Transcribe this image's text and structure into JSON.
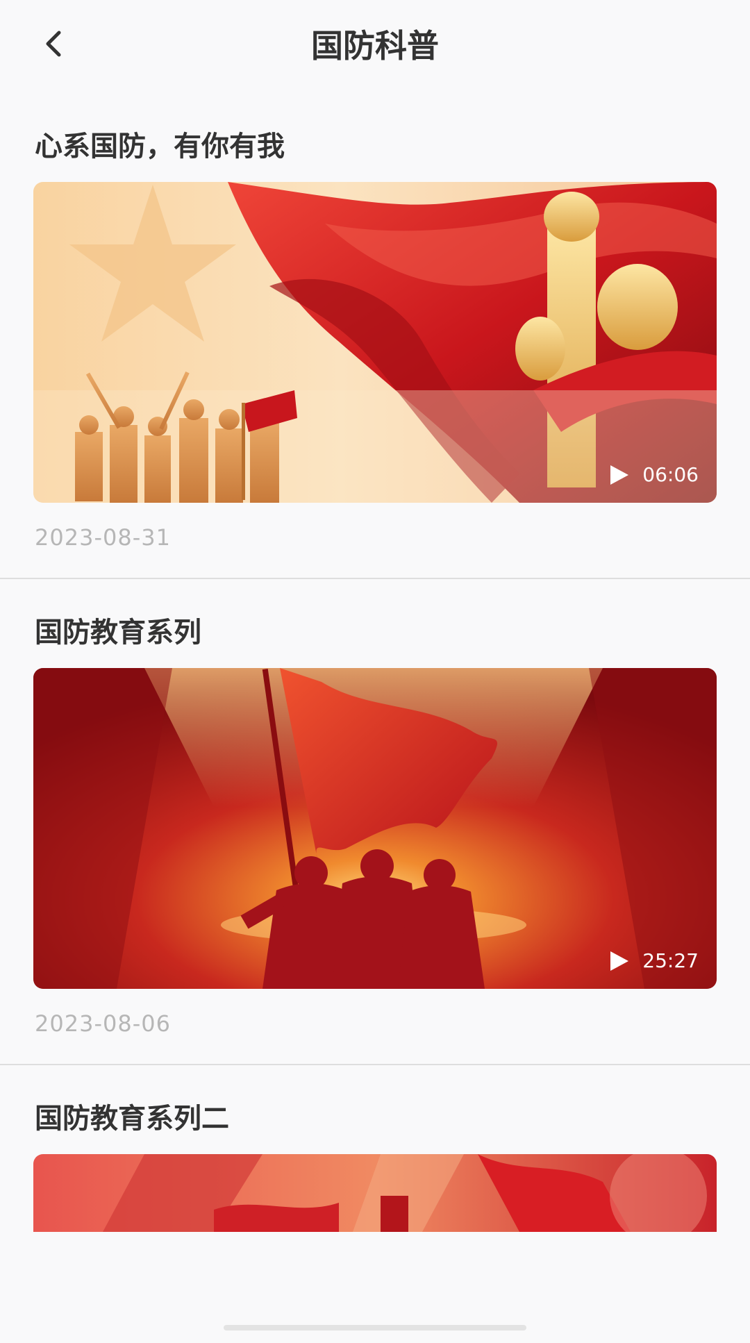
{
  "header": {
    "title": "国防科普",
    "back_icon": "chevron-left-icon"
  },
  "videos": [
    {
      "title": "心系国防，有你有我",
      "duration": "06:06",
      "date": "2023-08-31"
    },
    {
      "title": "国防教育系列",
      "duration": "25:27",
      "date": "2023-08-06"
    },
    {
      "title": "国防教育系列二"
    }
  ],
  "colors": {
    "background": "#f9f9fa",
    "text": "#333333",
    "date": "#b6b6b6",
    "accent_red": "#c8161d"
  }
}
